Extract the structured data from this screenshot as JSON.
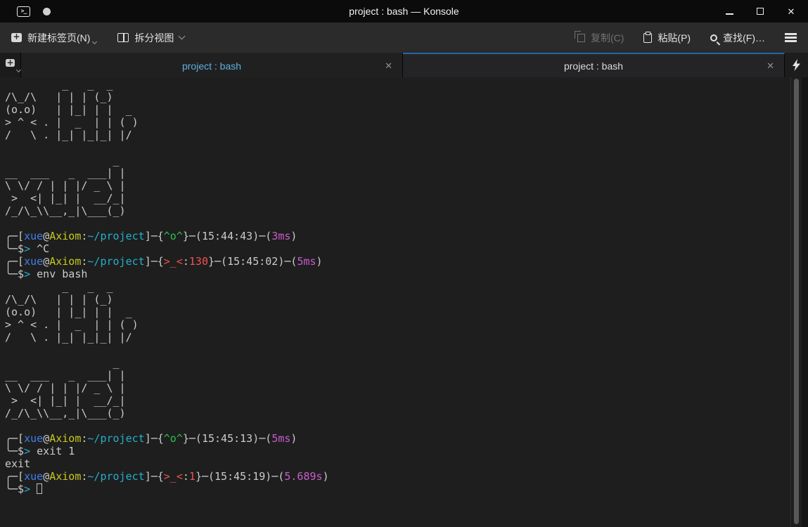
{
  "window": {
    "title": "project : bash — Konsole"
  },
  "toolbar": {
    "new_tab": "新建标签页(N)",
    "split_view": "拆分视图",
    "copy": "复制(C)",
    "paste": "粘贴(P)",
    "find": "查找(F)…"
  },
  "tabbar": {
    "tabs": [
      {
        "label": "project : bash"
      },
      {
        "label": "project : bash"
      }
    ],
    "close_glyph": "✕"
  },
  "terminal": {
    "palette": {
      "fg": "#cbcbcb",
      "red": "#ef5350",
      "green": "#2fc14e",
      "yellow": "#c9c81e",
      "blue": "#3f80e8",
      "magenta": "#cb5ccb",
      "cyan": "#24aecd"
    },
    "lines": [
      [
        {
          "t": "         _   _  _"
        }
      ],
      [
        {
          "t": "/\\_/\\   | | | (_)"
        }
      ],
      [
        {
          "t": "(o.o)   | |_| | |  _"
        }
      ],
      [
        {
          "t": "> ^ < . |  _  | | ( )"
        }
      ],
      [
        {
          "t": "/   \\ . |_| |_|_| |/"
        }
      ],
      [],
      [
        {
          "t": "                 _"
        }
      ],
      [
        {
          "t": "__  ___   _  ___| |"
        }
      ],
      [
        {
          "t": "\\ \\/ / | | |/ _ \\ |"
        }
      ],
      [
        {
          "t": " >  <| |_| |  __/_|"
        }
      ],
      [
        {
          "t": "/_/\\_\\\\__,_|\\___(_)"
        }
      ],
      [],
      [
        {
          "t": "╭─["
        },
        {
          "t": "xue",
          "c": "blue"
        },
        {
          "t": "@"
        },
        {
          "t": "Axiom",
          "c": "yellow"
        },
        {
          "t": ":"
        },
        {
          "t": "~/project",
          "c": "cyan"
        },
        {
          "t": "]─{"
        },
        {
          "t": "^o^",
          "c": "green"
        },
        {
          "t": "}─(15:44:43)─("
        },
        {
          "t": "3ms",
          "c": "magenta"
        },
        {
          "t": ")"
        }
      ],
      [
        {
          "t": "╰─$"
        },
        {
          "t": ">",
          "c": "cyan"
        },
        {
          "t": " ^C"
        }
      ],
      [
        {
          "t": "╭─["
        },
        {
          "t": "xue",
          "c": "blue"
        },
        {
          "t": "@"
        },
        {
          "t": "Axiom",
          "c": "yellow"
        },
        {
          "t": ":"
        },
        {
          "t": "~/project",
          "c": "cyan"
        },
        {
          "t": "]─{"
        },
        {
          "t": ">_<",
          "c": "red"
        },
        {
          "t": ":"
        },
        {
          "t": "130",
          "c": "red"
        },
        {
          "t": "}─(15:45:02)─("
        },
        {
          "t": "5ms",
          "c": "magenta"
        },
        {
          "t": ")"
        }
      ],
      [
        {
          "t": "╰─$"
        },
        {
          "t": ">",
          "c": "cyan"
        },
        {
          "t": " env bash"
        }
      ],
      [
        {
          "t": "         _   _  _"
        }
      ],
      [
        {
          "t": "/\\_/\\   | | | (_)"
        }
      ],
      [
        {
          "t": "(o.o)   | |_| | |  _"
        }
      ],
      [
        {
          "t": "> ^ < . |  _  | | ( )"
        }
      ],
      [
        {
          "t": "/   \\ . |_| |_|_| |/"
        }
      ],
      [],
      [
        {
          "t": "                 _"
        }
      ],
      [
        {
          "t": "__  ___   _  ___| |"
        }
      ],
      [
        {
          "t": "\\ \\/ / | | |/ _ \\ |"
        }
      ],
      [
        {
          "t": " >  <| |_| |  __/_|"
        }
      ],
      [
        {
          "t": "/_/\\_\\\\__,_|\\___(_)"
        }
      ],
      [],
      [
        {
          "t": "╭─["
        },
        {
          "t": "xue",
          "c": "blue"
        },
        {
          "t": "@"
        },
        {
          "t": "Axiom",
          "c": "yellow"
        },
        {
          "t": ":"
        },
        {
          "t": "~/project",
          "c": "cyan"
        },
        {
          "t": "]─{"
        },
        {
          "t": "^o^",
          "c": "green"
        },
        {
          "t": "}─(15:45:13)─("
        },
        {
          "t": "5ms",
          "c": "magenta"
        },
        {
          "t": ")"
        }
      ],
      [
        {
          "t": "╰─$"
        },
        {
          "t": ">",
          "c": "cyan"
        },
        {
          "t": " exit 1"
        }
      ],
      [
        {
          "t": "exit"
        }
      ],
      [
        {
          "t": "╭─["
        },
        {
          "t": "xue",
          "c": "blue"
        },
        {
          "t": "@"
        },
        {
          "t": "Axiom",
          "c": "yellow"
        },
        {
          "t": ":"
        },
        {
          "t": "~/project",
          "c": "cyan"
        },
        {
          "t": "]─{"
        },
        {
          "t": ">_<",
          "c": "red"
        },
        {
          "t": ":"
        },
        {
          "t": "1",
          "c": "red"
        },
        {
          "t": "}─(15:45:19)─("
        },
        {
          "t": "5.689s",
          "c": "magenta"
        },
        {
          "t": ")"
        }
      ],
      [
        {
          "t": "╰─$"
        },
        {
          "t": ">",
          "c": "cyan"
        },
        {
          "t": " "
        },
        {
          "cursor": true
        }
      ]
    ]
  }
}
